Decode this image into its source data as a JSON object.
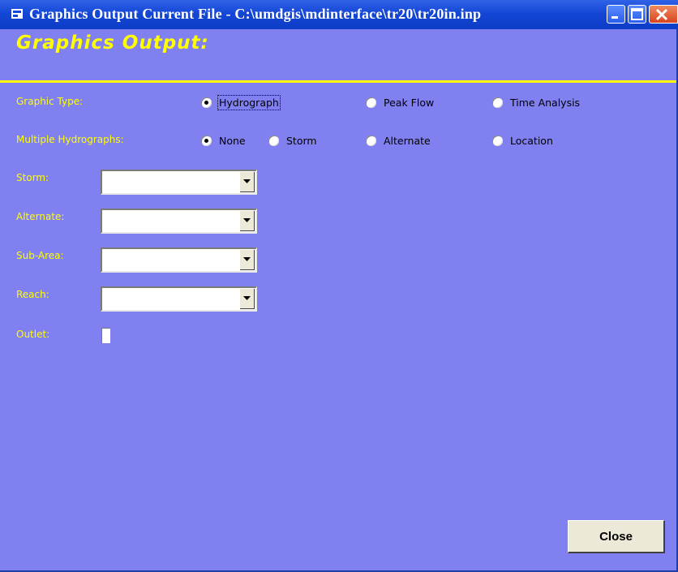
{
  "window": {
    "title": "Graphics Output   Current File - C:\\umdgis\\mdinterface\\tr20\\tr20in.inp"
  },
  "header": {
    "title": "Graphics Output:"
  },
  "graphic_type": {
    "label": "Graphic Type:",
    "options": [
      "Hydrograph",
      "Peak Flow",
      "Time Analysis"
    ],
    "selected": "Hydrograph"
  },
  "multiple_hydrographs": {
    "label": "Multiple Hydrographs:",
    "options": [
      "None",
      "Storm",
      "Alternate",
      "Location"
    ],
    "selected": "None"
  },
  "fields": {
    "storm_label": "Storm:",
    "alternate_label": "Alternate:",
    "subarea_label": "Sub-Area:",
    "reach_label": "Reach:",
    "outlet_label": "Outlet:"
  },
  "buttons": {
    "close_label": "Close"
  },
  "colors": {
    "form_bg": "#8080f0",
    "label": "#ffff00",
    "titlebar": "#1447d6"
  }
}
